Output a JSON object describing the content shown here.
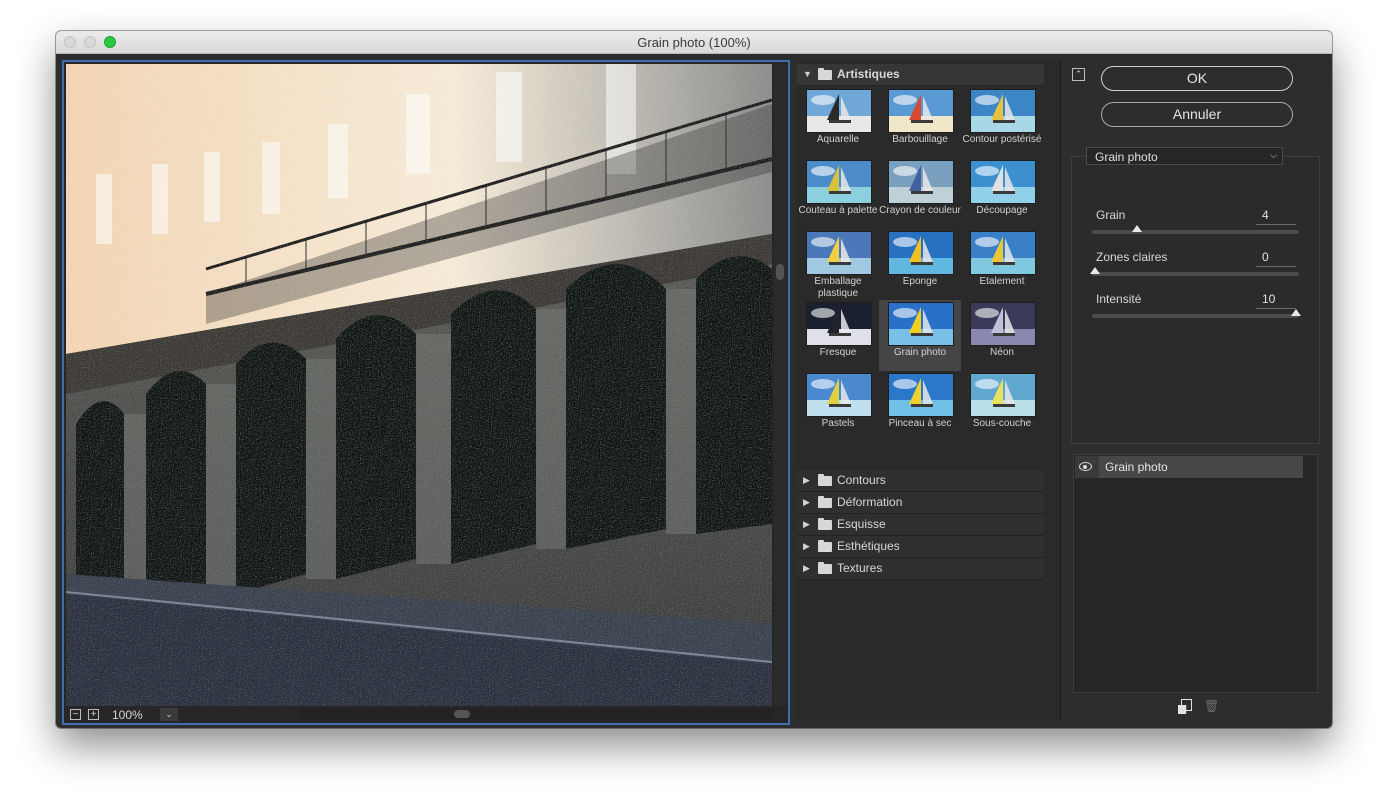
{
  "window": {
    "title": "Grain photo (100%)"
  },
  "preview": {
    "zoom": "100%",
    "zoom_out": "−",
    "zoom_in": "+",
    "zoom_menu": "⌄"
  },
  "gallery": {
    "open_category": "Artistiques",
    "filters": [
      {
        "label": "Aquarelle"
      },
      {
        "label": "Barbouillage"
      },
      {
        "label": "Contour postérisé"
      },
      {
        "label": "Couteau à palette"
      },
      {
        "label": "Crayon de couleur"
      },
      {
        "label": "Découpage"
      },
      {
        "label": "Emballage plastique"
      },
      {
        "label": "Eponge"
      },
      {
        "label": "Etalement"
      },
      {
        "label": "Fresque"
      },
      {
        "label": "Grain photo",
        "selected": true
      },
      {
        "label": "Néon"
      },
      {
        "label": "Pastels"
      },
      {
        "label": "Pinceau à sec"
      },
      {
        "label": "Sous-couche"
      }
    ],
    "closed_categories": [
      "Contours",
      "Déformation",
      "Esquisse",
      "Esthétiques",
      "Textures"
    ]
  },
  "panel": {
    "ok_label": "OK",
    "cancel_label": "Annuler",
    "filter_select": "Grain photo",
    "params": [
      {
        "label": "Grain",
        "value": "4",
        "fraction": 0.21
      },
      {
        "label": "Zones claires",
        "value": "0",
        "fraction": 0.0
      },
      {
        "label": "Intensité",
        "value": "10",
        "fraction": 1.0
      }
    ],
    "layer_name": "Grain photo"
  },
  "colors": {
    "accent": "#3f6eb0",
    "close": "#d8d8d8",
    "maximize": "#2ac840"
  },
  "icons": [
    "eye-icon",
    "folder-icon",
    "new-effect-layer-icon",
    "trash-icon",
    "collapse-icon"
  ]
}
